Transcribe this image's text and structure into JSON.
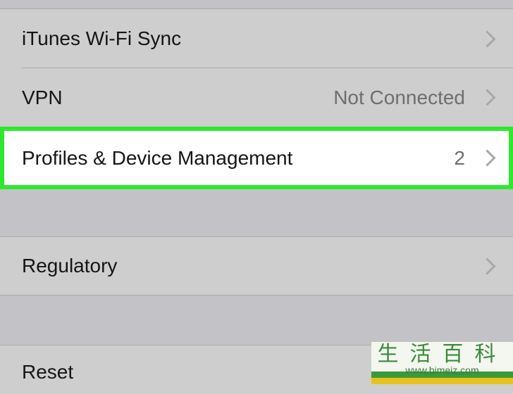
{
  "rows": [
    {
      "label": "iTunes Wi-Fi Sync",
      "value": ""
    },
    {
      "label": "VPN",
      "value": "Not Connected"
    },
    {
      "label": "Profiles & Device Management",
      "value": "2"
    },
    {
      "label": "Regulatory",
      "value": ""
    },
    {
      "label": "Reset",
      "value": ""
    }
  ],
  "highlight_color": "#2ee82e",
  "watermark": {
    "chinese": "生活百科",
    "url": "www.bimeiz.com"
  }
}
